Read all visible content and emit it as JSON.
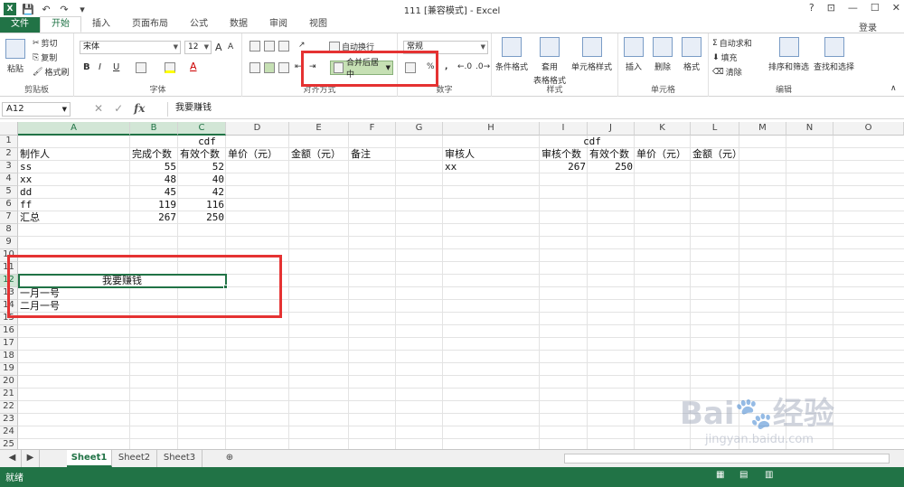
{
  "window": {
    "title": "111 [兼容模式] - Excel",
    "login": "登录",
    "controls": [
      "?",
      "⊡",
      "—",
      "☐",
      "✕"
    ]
  },
  "quick_access": [
    "save-icon",
    "undo-icon",
    "redo-icon"
  ],
  "menu": {
    "tabs": [
      "文件",
      "开始",
      "插入",
      "页面布局",
      "公式",
      "数据",
      "审阅",
      "视图"
    ],
    "active": "开始"
  },
  "ribbon": {
    "clipboard": {
      "paste": "粘贴",
      "cut": "剪切",
      "copy": "复制",
      "format_painter": "格式刷",
      "label": "剪贴板"
    },
    "font": {
      "name": "宋体",
      "size": "12",
      "grow": "A",
      "shrink": "A",
      "bold": "B",
      "italic": "I",
      "underline": "U",
      "label": "字体"
    },
    "alignment": {
      "wrap": "自动换行",
      "merge": "合并后居中",
      "label": "对齐方式"
    },
    "number": {
      "format": "常规",
      "percent": "%",
      "comma": ",",
      "label": "数字"
    },
    "styles": {
      "conditional": "条件格式",
      "table": "套用",
      "table2": "表格格式",
      "cell": "单元格样式",
      "label": "样式"
    },
    "cells": {
      "insert": "插入",
      "delete": "删除",
      "format": "格式",
      "label": "单元格"
    },
    "editing": {
      "autosum": "自动求和",
      "fill": "填充",
      "clear": "清除",
      "sort": "排序和筛选",
      "find": "查找和选择",
      "label": "编辑"
    }
  },
  "formula_bar": {
    "name_box": "A12",
    "fx": "fx",
    "value": "我要赚钱"
  },
  "columns": [
    "A",
    "B",
    "C",
    "D",
    "E",
    "F",
    "G",
    "H",
    "I",
    "J",
    "K",
    "L",
    "M",
    "N",
    "O"
  ],
  "rows": [
    "1",
    "2",
    "3",
    "4",
    "5",
    "6",
    "7",
    "8",
    "9",
    "10",
    "11",
    "12",
    "13",
    "14",
    "15",
    "16",
    "17",
    "18",
    "19",
    "20",
    "21",
    "22",
    "23",
    "24",
    "25"
  ],
  "cells": {
    "r1_title_left": "cdf",
    "r1_title_right": "cdf",
    "r2": [
      "制作人",
      "完成个数",
      "有效个数",
      "单价（元）",
      "金额（元）",
      "备注"
    ],
    "r2_right": [
      "审核人",
      "审核个数",
      "有效个数",
      "单价（元）",
      "金额（元）"
    ],
    "data": [
      [
        "ss",
        "55",
        "52"
      ],
      [
        "xx",
        "48",
        "40"
      ],
      [
        "dd",
        "45",
        "42"
      ],
      [
        "ff",
        "119",
        "116"
      ],
      [
        "汇总",
        "267",
        "250"
      ]
    ],
    "h3": "xx",
    "i3": "267",
    "j3": "250",
    "a12": "我要赚钱",
    "a13": "一月一号",
    "a14": "二月一号"
  },
  "sheets": [
    "Sheet1",
    "Sheet2",
    "Sheet3"
  ],
  "active_sheet": "Sheet1",
  "status": "就绪",
  "watermark": {
    "brand": "Bai",
    "brand2": "经验",
    "url": "jingyan.baidu.com"
  },
  "colors": {
    "excel_green": "#217346",
    "highlight_red": "#e53232",
    "merge_button": "#c6e0b4"
  }
}
